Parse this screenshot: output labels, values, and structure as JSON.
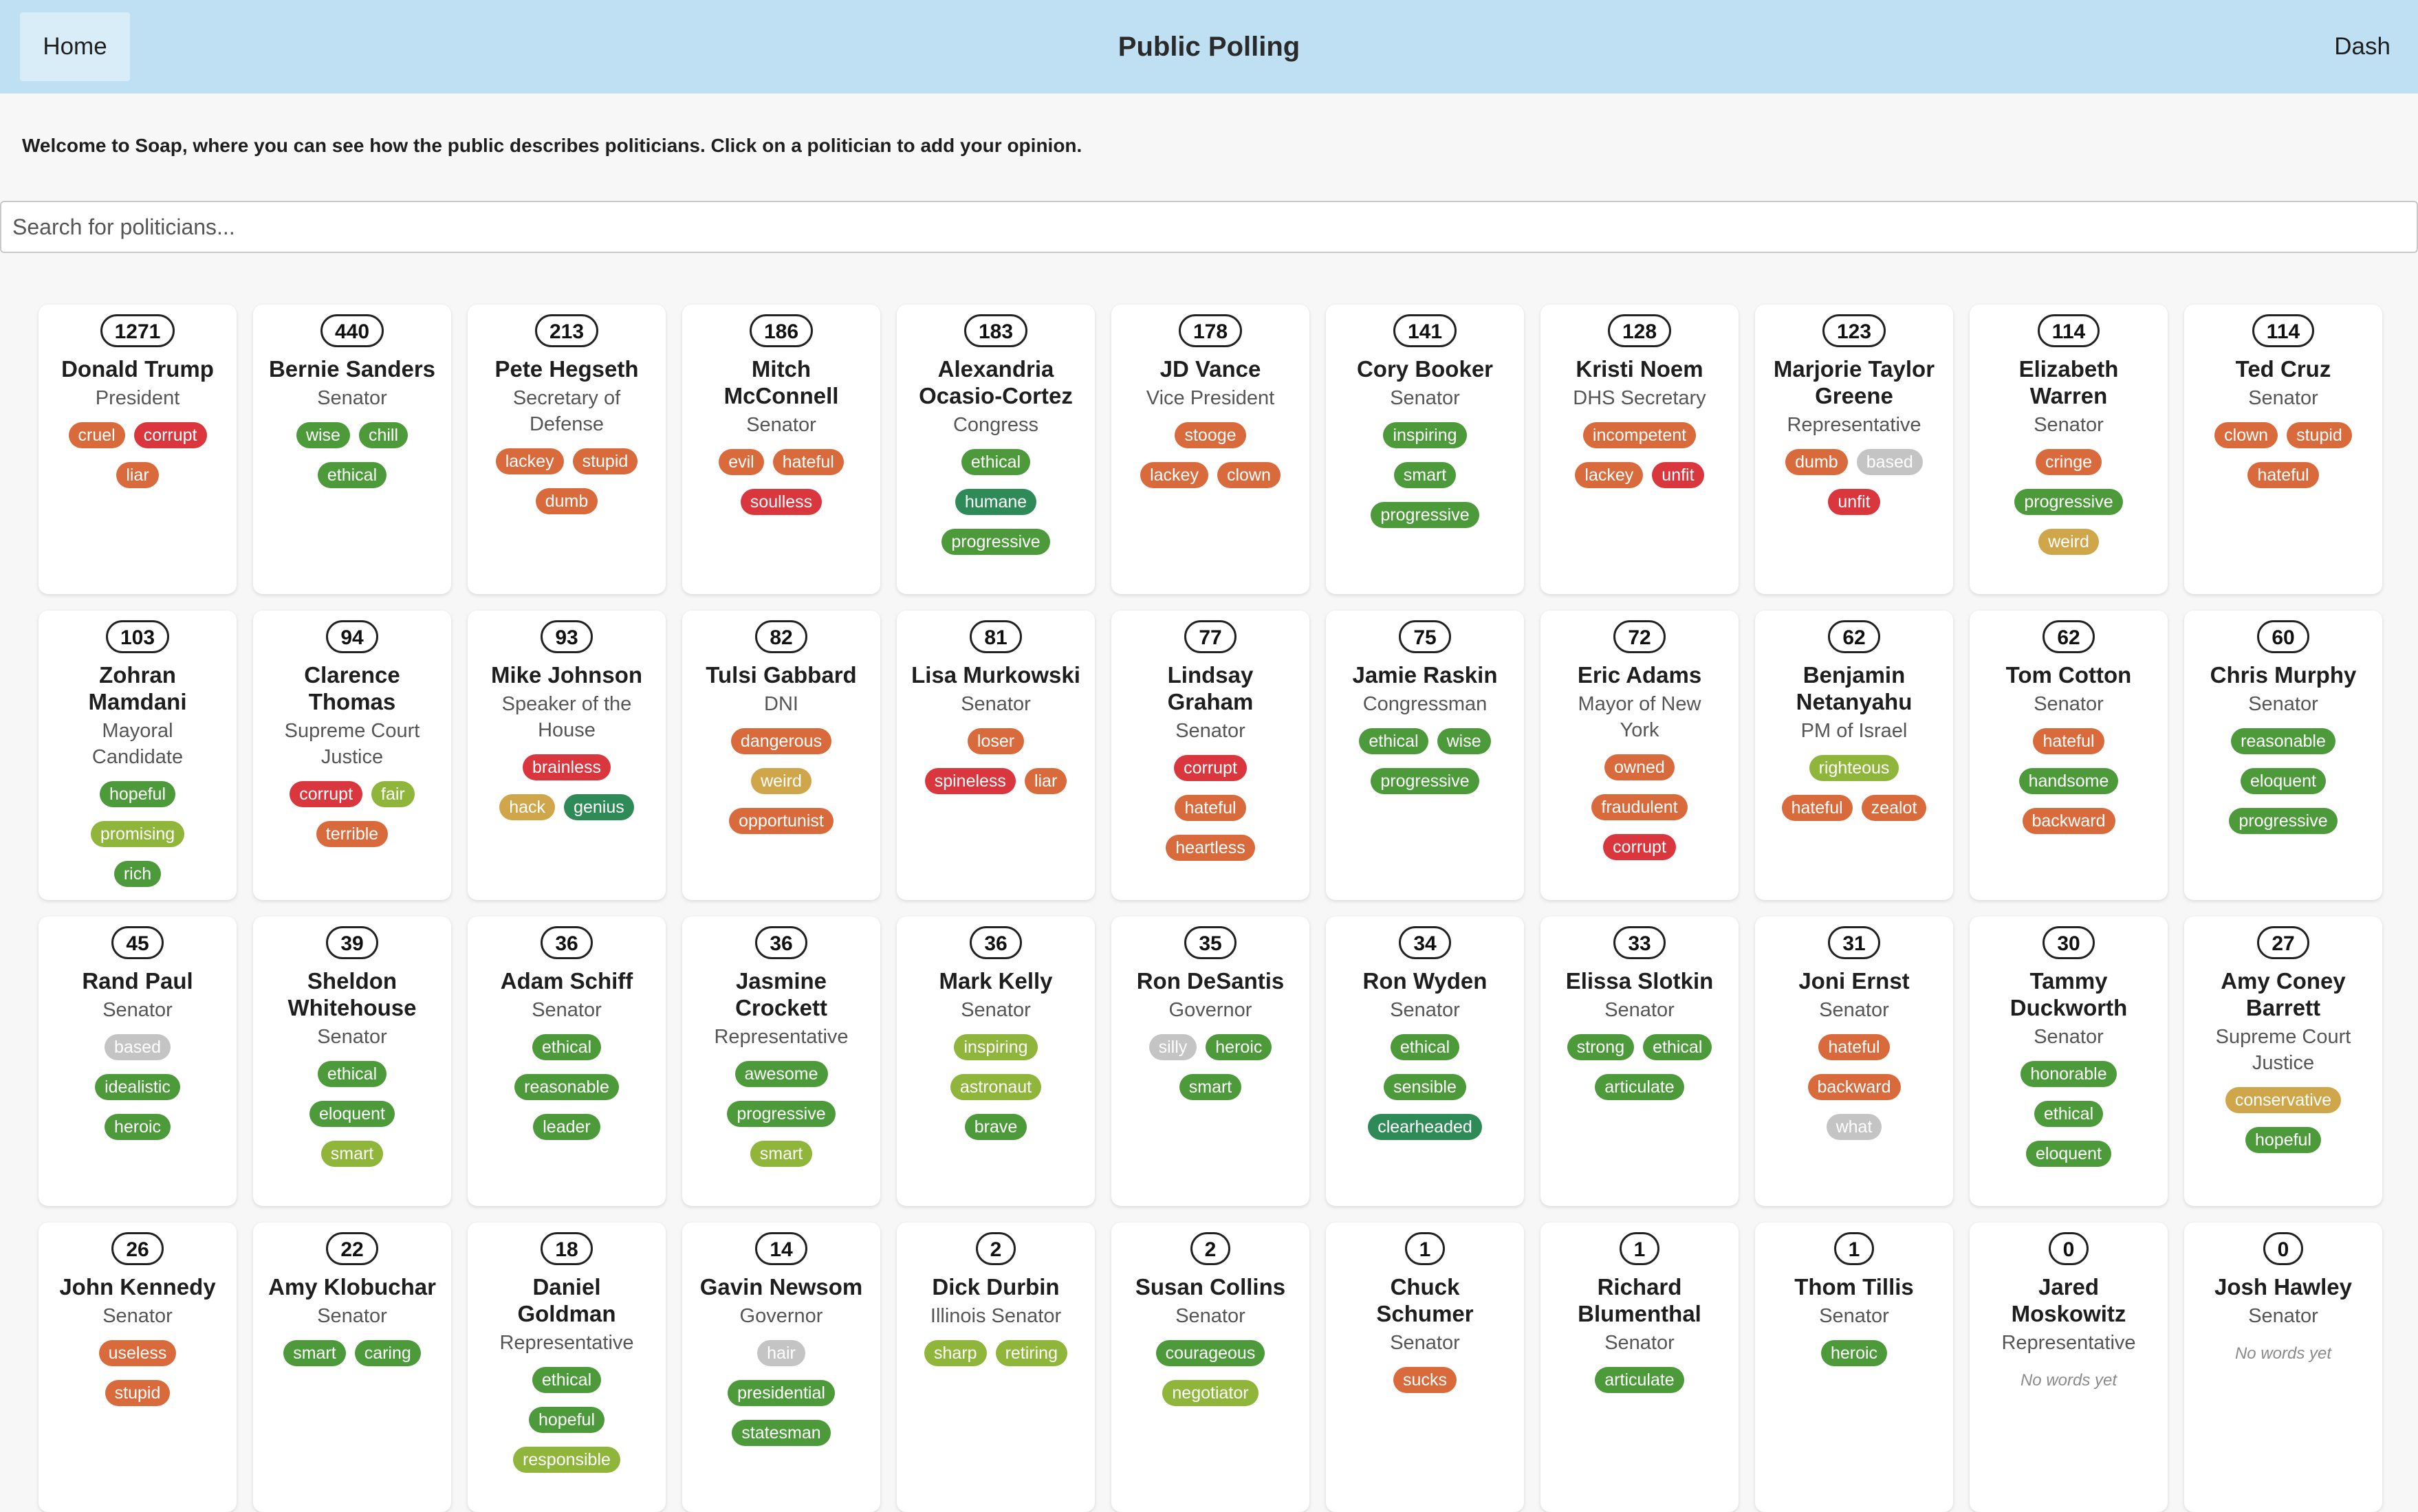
{
  "nav": {
    "home_label": "Home",
    "title": "Public Polling",
    "dash_label": "Dash"
  },
  "welcome": "Welcome to Soap, where you can see how the public describes politicians. Click on a politician to add your opinion.",
  "search": {
    "placeholder": "Search for politicians..."
  },
  "no_words_label": "No words yet",
  "tag_colors": {
    "red": "#d9363e",
    "orange": "#d96a3c",
    "amber": "#d0a64a",
    "olive": "#8fb53b",
    "green": "#4d9a3b",
    "teal": "#2e8a56",
    "gray": "#c4c4c4"
  },
  "politicians": [
    {
      "count": "1271",
      "name": "Donald Trump",
      "role": "President",
      "tags": [
        {
          "t": "cruel",
          "c": "orange"
        },
        {
          "t": "corrupt",
          "c": "red"
        },
        {
          "t": "liar",
          "c": "orange"
        }
      ]
    },
    {
      "count": "440",
      "name": "Bernie Sanders",
      "role": "Senator",
      "tags": [
        {
          "t": "wise",
          "c": "green"
        },
        {
          "t": "chill",
          "c": "green"
        },
        {
          "t": "ethical",
          "c": "green"
        }
      ]
    },
    {
      "count": "213",
      "name": "Pete Hegseth",
      "role": "Secretary of Defense",
      "tags": [
        {
          "t": "lackey",
          "c": "orange"
        },
        {
          "t": "stupid",
          "c": "orange"
        },
        {
          "t": "dumb",
          "c": "orange"
        }
      ]
    },
    {
      "count": "186",
      "name": "Mitch McConnell",
      "role": "Senator",
      "tags": [
        {
          "t": "evil",
          "c": "orange"
        },
        {
          "t": "hateful",
          "c": "orange"
        },
        {
          "t": "soulless",
          "c": "red"
        }
      ]
    },
    {
      "count": "183",
      "name": "Alexandria Ocasio-Cortez",
      "role": "Congress",
      "tags": [
        {
          "t": "ethical",
          "c": "green"
        },
        {
          "t": "humane",
          "c": "teal"
        },
        {
          "t": "progressive",
          "c": "green"
        }
      ]
    },
    {
      "count": "178",
      "name": "JD Vance",
      "role": "Vice President",
      "tags": [
        {
          "t": "stooge",
          "c": "orange"
        },
        {
          "t": "lackey",
          "c": "orange"
        },
        {
          "t": "clown",
          "c": "orange"
        }
      ]
    },
    {
      "count": "141",
      "name": "Cory Booker",
      "role": "Senator",
      "tags": [
        {
          "t": "inspiring",
          "c": "green"
        },
        {
          "t": "smart",
          "c": "green"
        },
        {
          "t": "progressive",
          "c": "green"
        }
      ]
    },
    {
      "count": "128",
      "name": "Kristi Noem",
      "role": "DHS Secretary",
      "tags": [
        {
          "t": "incompetent",
          "c": "orange"
        },
        {
          "t": "lackey",
          "c": "orange"
        },
        {
          "t": "unfit",
          "c": "red"
        }
      ]
    },
    {
      "count": "123",
      "name": "Marjorie Taylor Greene",
      "role": "Representative",
      "tags": [
        {
          "t": "dumb",
          "c": "orange"
        },
        {
          "t": "based",
          "c": "gray"
        },
        {
          "t": "unfit",
          "c": "red"
        }
      ]
    },
    {
      "count": "114",
      "name": "Elizabeth Warren",
      "role": "Senator",
      "tags": [
        {
          "t": "cringe",
          "c": "orange"
        },
        {
          "t": "progressive",
          "c": "green"
        },
        {
          "t": "weird",
          "c": "amber"
        }
      ]
    },
    {
      "count": "114",
      "name": "Ted Cruz",
      "role": "Senator",
      "tags": [
        {
          "t": "clown",
          "c": "orange"
        },
        {
          "t": "stupid",
          "c": "orange"
        },
        {
          "t": "hateful",
          "c": "orange"
        }
      ]
    },
    {
      "count": "103",
      "name": "Zohran Mamdani",
      "role": "Mayoral Candidate",
      "tags": [
        {
          "t": "hopeful",
          "c": "green"
        },
        {
          "t": "promising",
          "c": "olive"
        },
        {
          "t": "rich",
          "c": "green"
        }
      ]
    },
    {
      "count": "94",
      "name": "Clarence Thomas",
      "role": "Supreme Court Justice",
      "tags": [
        {
          "t": "corrupt",
          "c": "red"
        },
        {
          "t": "fair",
          "c": "olive"
        },
        {
          "t": "terrible",
          "c": "orange"
        }
      ]
    },
    {
      "count": "93",
      "name": "Mike Johnson",
      "role": "Speaker of the House",
      "tags": [
        {
          "t": "brainless",
          "c": "red"
        },
        {
          "t": "hack",
          "c": "amber"
        },
        {
          "t": "genius",
          "c": "teal"
        }
      ]
    },
    {
      "count": "82",
      "name": "Tulsi Gabbard",
      "role": "DNI",
      "tags": [
        {
          "t": "dangerous",
          "c": "orange"
        },
        {
          "t": "weird",
          "c": "amber"
        },
        {
          "t": "opportunist",
          "c": "orange"
        }
      ]
    },
    {
      "count": "81",
      "name": "Lisa Murkowski",
      "role": "Senator",
      "tags": [
        {
          "t": "loser",
          "c": "orange"
        },
        {
          "t": "spineless",
          "c": "red"
        },
        {
          "t": "liar",
          "c": "orange"
        }
      ]
    },
    {
      "count": "77",
      "name": "Lindsay Graham",
      "role": "Senator",
      "tags": [
        {
          "t": "corrupt",
          "c": "red"
        },
        {
          "t": "hateful",
          "c": "orange"
        },
        {
          "t": "heartless",
          "c": "orange"
        }
      ]
    },
    {
      "count": "75",
      "name": "Jamie Raskin",
      "role": "Congressman",
      "tags": [
        {
          "t": "ethical",
          "c": "green"
        },
        {
          "t": "wise",
          "c": "green"
        },
        {
          "t": "progressive",
          "c": "green"
        }
      ]
    },
    {
      "count": "72",
      "name": "Eric Adams",
      "role": "Mayor of New York",
      "tags": [
        {
          "t": "owned",
          "c": "orange"
        },
        {
          "t": "fraudulent",
          "c": "orange"
        },
        {
          "t": "corrupt",
          "c": "red"
        }
      ]
    },
    {
      "count": "62",
      "name": "Benjamin Netanyahu",
      "role": "PM of Israel",
      "tags": [
        {
          "t": "righteous",
          "c": "olive"
        },
        {
          "t": "hateful",
          "c": "orange"
        },
        {
          "t": "zealot",
          "c": "orange"
        }
      ]
    },
    {
      "count": "62",
      "name": "Tom Cotton",
      "role": "Senator",
      "tags": [
        {
          "t": "hateful",
          "c": "orange"
        },
        {
          "t": "handsome",
          "c": "green"
        },
        {
          "t": "backward",
          "c": "orange"
        }
      ]
    },
    {
      "count": "60",
      "name": "Chris Murphy",
      "role": "Senator",
      "tags": [
        {
          "t": "reasonable",
          "c": "green"
        },
        {
          "t": "eloquent",
          "c": "green"
        },
        {
          "t": "progressive",
          "c": "green"
        }
      ]
    },
    {
      "count": "45",
      "name": "Rand Paul",
      "role": "Senator",
      "tags": [
        {
          "t": "based",
          "c": "gray"
        },
        {
          "t": "idealistic",
          "c": "green"
        },
        {
          "t": "heroic",
          "c": "green"
        }
      ]
    },
    {
      "count": "39",
      "name": "Sheldon Whitehouse",
      "role": "Senator",
      "tags": [
        {
          "t": "ethical",
          "c": "green"
        },
        {
          "t": "eloquent",
          "c": "green"
        },
        {
          "t": "smart",
          "c": "olive"
        }
      ]
    },
    {
      "count": "36",
      "name": "Adam Schiff",
      "role": "Senator",
      "tags": [
        {
          "t": "ethical",
          "c": "green"
        },
        {
          "t": "reasonable",
          "c": "green"
        },
        {
          "t": "leader",
          "c": "green"
        }
      ]
    },
    {
      "count": "36",
      "name": "Jasmine Crockett",
      "role": "Representative",
      "tags": [
        {
          "t": "awesome",
          "c": "green"
        },
        {
          "t": "progressive",
          "c": "green"
        },
        {
          "t": "smart",
          "c": "olive"
        }
      ]
    },
    {
      "count": "36",
      "name": "Mark Kelly",
      "role": "Senator",
      "tags": [
        {
          "t": "inspiring",
          "c": "olive"
        },
        {
          "t": "astronaut",
          "c": "olive"
        },
        {
          "t": "brave",
          "c": "green"
        }
      ]
    },
    {
      "count": "35",
      "name": "Ron DeSantis",
      "role": "Governor",
      "tags": [
        {
          "t": "silly",
          "c": "gray"
        },
        {
          "t": "heroic",
          "c": "green"
        },
        {
          "t": "smart",
          "c": "green"
        }
      ]
    },
    {
      "count": "34",
      "name": "Ron Wyden",
      "role": "Senator",
      "tags": [
        {
          "t": "ethical",
          "c": "green"
        },
        {
          "t": "sensible",
          "c": "green"
        },
        {
          "t": "clearheaded",
          "c": "teal"
        }
      ]
    },
    {
      "count": "33",
      "name": "Elissa Slotkin",
      "role": "Senator",
      "tags": [
        {
          "t": "strong",
          "c": "green"
        },
        {
          "t": "ethical",
          "c": "green"
        },
        {
          "t": "articulate",
          "c": "green"
        }
      ]
    },
    {
      "count": "31",
      "name": "Joni Ernst",
      "role": "Senator",
      "tags": [
        {
          "t": "hateful",
          "c": "orange"
        },
        {
          "t": "backward",
          "c": "orange"
        },
        {
          "t": "what",
          "c": "gray"
        }
      ]
    },
    {
      "count": "30",
      "name": "Tammy Duckworth",
      "role": "Senator",
      "tags": [
        {
          "t": "honorable",
          "c": "green"
        },
        {
          "t": "ethical",
          "c": "green"
        },
        {
          "t": "eloquent",
          "c": "green"
        }
      ]
    },
    {
      "count": "27",
      "name": "Amy Coney Barrett",
      "role": "Supreme Court Justice",
      "tags": [
        {
          "t": "conservative",
          "c": "amber"
        },
        {
          "t": "hopeful",
          "c": "green"
        }
      ]
    },
    {
      "count": "26",
      "name": "John Kennedy",
      "role": "Senator",
      "tags": [
        {
          "t": "useless",
          "c": "orange"
        },
        {
          "t": "stupid",
          "c": "orange"
        }
      ]
    },
    {
      "count": "22",
      "name": "Amy Klobuchar",
      "role": "Senator",
      "tags": [
        {
          "t": "smart",
          "c": "green"
        },
        {
          "t": "caring",
          "c": "green"
        }
      ]
    },
    {
      "count": "18",
      "name": "Daniel Goldman",
      "role": "Representative",
      "tags": [
        {
          "t": "ethical",
          "c": "green"
        },
        {
          "t": "hopeful",
          "c": "green"
        },
        {
          "t": "responsible",
          "c": "olive"
        }
      ]
    },
    {
      "count": "14",
      "name": "Gavin Newsom",
      "role": "Governor",
      "tags": [
        {
          "t": "hair",
          "c": "gray"
        },
        {
          "t": "presidential",
          "c": "green"
        },
        {
          "t": "statesman",
          "c": "green"
        }
      ]
    },
    {
      "count": "2",
      "name": "Dick Durbin",
      "role": "Illinois Senator",
      "tags": [
        {
          "t": "sharp",
          "c": "olive"
        },
        {
          "t": "retiring",
          "c": "olive"
        }
      ]
    },
    {
      "count": "2",
      "name": "Susan Collins",
      "role": "Senator",
      "tags": [
        {
          "t": "courageous",
          "c": "green"
        },
        {
          "t": "negotiator",
          "c": "olive"
        }
      ]
    },
    {
      "count": "1",
      "name": "Chuck Schumer",
      "role": "Senator",
      "tags": [
        {
          "t": "sucks",
          "c": "orange"
        }
      ]
    },
    {
      "count": "1",
      "name": "Richard Blumenthal",
      "role": "Senator",
      "tags": [
        {
          "t": "articulate",
          "c": "green"
        }
      ]
    },
    {
      "count": "1",
      "name": "Thom Tillis",
      "role": "Senator",
      "tags": [
        {
          "t": "heroic",
          "c": "green"
        }
      ]
    },
    {
      "count": "0",
      "name": "Jared Moskowitz",
      "role": "Representative",
      "tags": []
    },
    {
      "count": "0",
      "name": "Josh Hawley",
      "role": "Senator",
      "tags": []
    }
  ]
}
